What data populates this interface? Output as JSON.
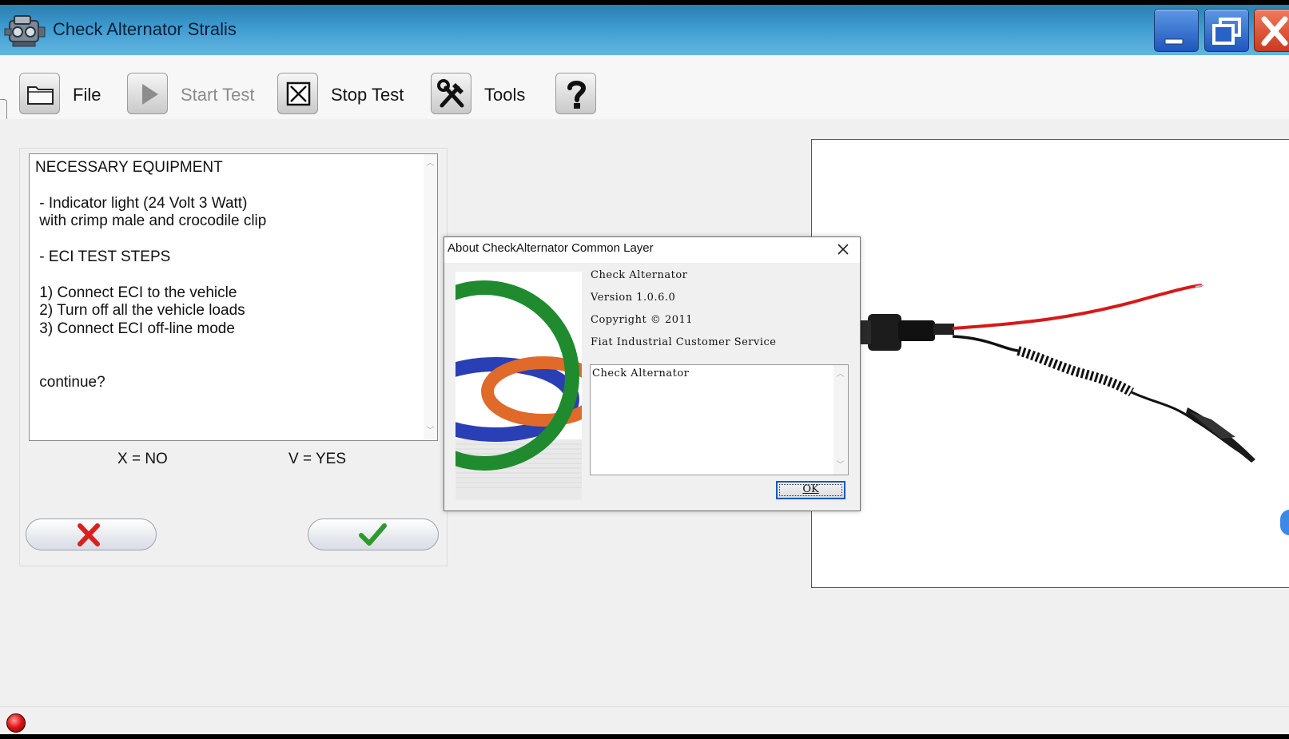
{
  "window": {
    "title": "Check Alternator Stralis",
    "controls": {
      "minimize": "minimize",
      "maximize": "maximize",
      "close": "close"
    }
  },
  "toolbar": {
    "items": [
      {
        "label": "File",
        "icon": "folder-icon",
        "enabled": true
      },
      {
        "label": "Start Test",
        "icon": "play-icon",
        "enabled": false
      },
      {
        "label": "Stop Test",
        "icon": "stop-icon",
        "enabled": true
      },
      {
        "label": "Tools",
        "icon": "tools-icon",
        "enabled": true
      },
      {
        "label": "",
        "icon": "help-icon",
        "enabled": true
      }
    ]
  },
  "instructions": {
    "text": "NECESSARY EQUIPMENT\n\n - Indicator light (24 Volt 3 Watt)\n with crimp male and crocodile clip\n\n - ECI TEST STEPS\n\n 1) Connect ECI to the vehicle\n 2) Turn off all the vehicle loads\n 3) Connect ECI off-line mode\n\n\n continue?",
    "option_no": "X = NO",
    "option_yes": "V = YES"
  },
  "about_dialog": {
    "title": "About CheckAlternator Common Layer",
    "product": "Check Alternator",
    "version": "Version 1.0.6.0",
    "copyright": "Copyright © 2011",
    "company": "Fiat Industrial Customer Service",
    "description": "Check Alternator",
    "ok_label": "OK"
  },
  "colors": {
    "titlebar": "#3e9bd0",
    "close_button": "#d9452a",
    "accent_button": "#1a57c0",
    "status_led": "#e01818",
    "no_button": "#d82020",
    "yes_button": "#2e9a2e"
  }
}
